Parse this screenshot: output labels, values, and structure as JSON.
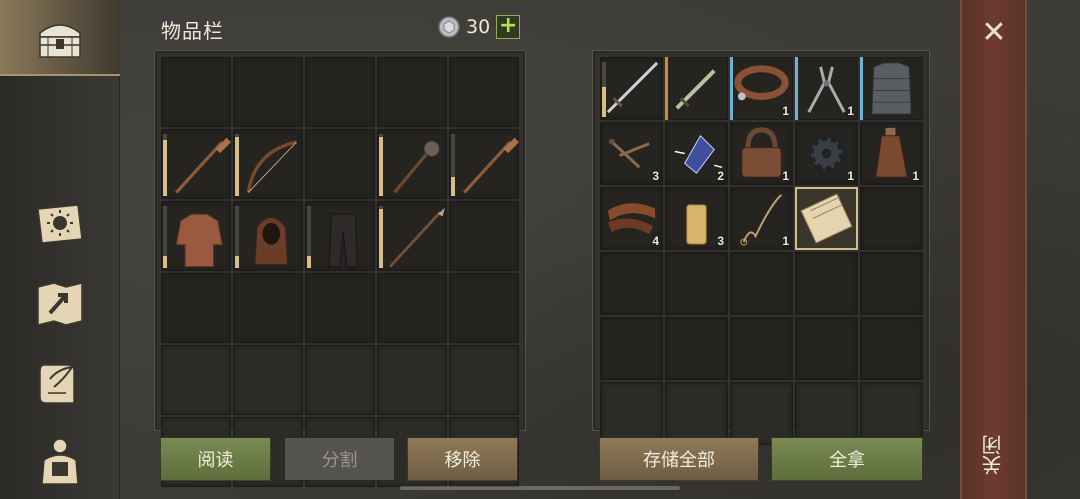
{
  "header": {
    "title": "物品栏",
    "coins": "30",
    "plus": "+"
  },
  "nav": {
    "tabs": [
      {
        "name": "inventory-chest-icon",
        "active": true
      },
      {
        "name": "sun-book-icon",
        "active": false
      },
      {
        "name": "map-icon",
        "active": false
      },
      {
        "name": "scroll-quill-icon",
        "active": false
      },
      {
        "name": "character-backpack-icon",
        "active": false
      }
    ]
  },
  "player_inventory": {
    "slots": [
      {
        "item": "",
        "qty": "",
        "durability": 0
      },
      {
        "item": "",
        "qty": "",
        "durability": 0
      },
      {
        "item": "",
        "qty": "",
        "durability": 0
      },
      {
        "item": "",
        "qty": "",
        "durability": 0
      },
      {
        "item": "",
        "qty": "",
        "durability": 0
      },
      {
        "item": "oar",
        "qty": "",
        "durability": 0.9
      },
      {
        "item": "bow",
        "qty": "",
        "durability": 0.95
      },
      {
        "item": "",
        "qty": "",
        "durability": 0
      },
      {
        "item": "mace",
        "qty": "",
        "durability": 0.95
      },
      {
        "item": "oar",
        "qty": "",
        "durability": 0.3
      },
      {
        "item": "gambeson",
        "qty": "",
        "durability": 0.2
      },
      {
        "item": "hood",
        "qty": "",
        "durability": 0.2
      },
      {
        "item": "pants",
        "qty": "",
        "durability": 0.2
      },
      {
        "item": "spear",
        "qty": "",
        "durability": 0.95
      },
      {
        "item": "",
        "qty": "",
        "durability": 0
      },
      {
        "item": "",
        "qty": "",
        "durability": 0
      },
      {
        "item": "",
        "qty": "",
        "durability": 0
      },
      {
        "item": "",
        "qty": "",
        "durability": 0
      },
      {
        "item": "",
        "qty": "",
        "durability": 0
      },
      {
        "item": "",
        "qty": "",
        "durability": 0
      },
      {
        "item": "",
        "qty": "",
        "durability": 0,
        "faded": true
      },
      {
        "item": "",
        "qty": "",
        "durability": 0,
        "faded": true
      },
      {
        "item": "",
        "qty": "",
        "durability": 0,
        "faded": true
      },
      {
        "item": "",
        "qty": "",
        "durability": 0,
        "faded": true
      },
      {
        "item": "",
        "qty": "",
        "durability": 0,
        "faded": true
      },
      {
        "item": "",
        "qty": "",
        "durability": 0,
        "faded": true
      },
      {
        "item": "",
        "qty": "",
        "durability": 0,
        "faded": true
      },
      {
        "item": "",
        "qty": "",
        "durability": 0,
        "faded": true
      },
      {
        "item": "",
        "qty": "",
        "durability": 0,
        "faded": true
      },
      {
        "item": "",
        "qty": "",
        "durability": 0,
        "faded": true
      }
    ]
  },
  "container_inventory": {
    "slots": [
      {
        "item": "sword",
        "qty": "",
        "durability": 0.55
      },
      {
        "item": "dagger",
        "qty": "",
        "rarity": "orange"
      },
      {
        "item": "collar",
        "qty": "1",
        "rarity": "blue"
      },
      {
        "item": "pliers",
        "qty": "1",
        "rarity": "blue"
      },
      {
        "item": "chainmail",
        "qty": "",
        "rarity": "blue"
      },
      {
        "item": "nails",
        "qty": "3"
      },
      {
        "item": "crystal",
        "qty": "2"
      },
      {
        "item": "padlock",
        "qty": "1"
      },
      {
        "item": "gear",
        "qty": "1"
      },
      {
        "item": "flask",
        "qty": "1"
      },
      {
        "item": "leather",
        "qty": "4"
      },
      {
        "item": "candle",
        "qty": "3"
      },
      {
        "item": "rope",
        "qty": "1"
      },
      {
        "item": "scroll",
        "qty": "",
        "selected": true
      },
      {
        "item": "",
        "qty": ""
      },
      {
        "item": "",
        "qty": ""
      },
      {
        "item": "",
        "qty": ""
      },
      {
        "item": "",
        "qty": ""
      },
      {
        "item": "",
        "qty": ""
      },
      {
        "item": "",
        "qty": ""
      },
      {
        "item": "",
        "qty": ""
      },
      {
        "item": "",
        "qty": ""
      },
      {
        "item": "",
        "qty": ""
      },
      {
        "item": "",
        "qty": ""
      },
      {
        "item": "",
        "qty": ""
      },
      {
        "item": "",
        "qty": "",
        "faded": true
      },
      {
        "item": "",
        "qty": "",
        "faded": true
      },
      {
        "item": "",
        "qty": "",
        "faded": true
      },
      {
        "item": "",
        "qty": "",
        "faded": true
      },
      {
        "item": "",
        "qty": "",
        "faded": true
      }
    ]
  },
  "buttons": {
    "read": "阅读",
    "split": "分割",
    "remove": "移除",
    "store_all": "存储全部",
    "take_all": "全拿"
  },
  "close": {
    "label": "关闭",
    "x": "✕"
  }
}
